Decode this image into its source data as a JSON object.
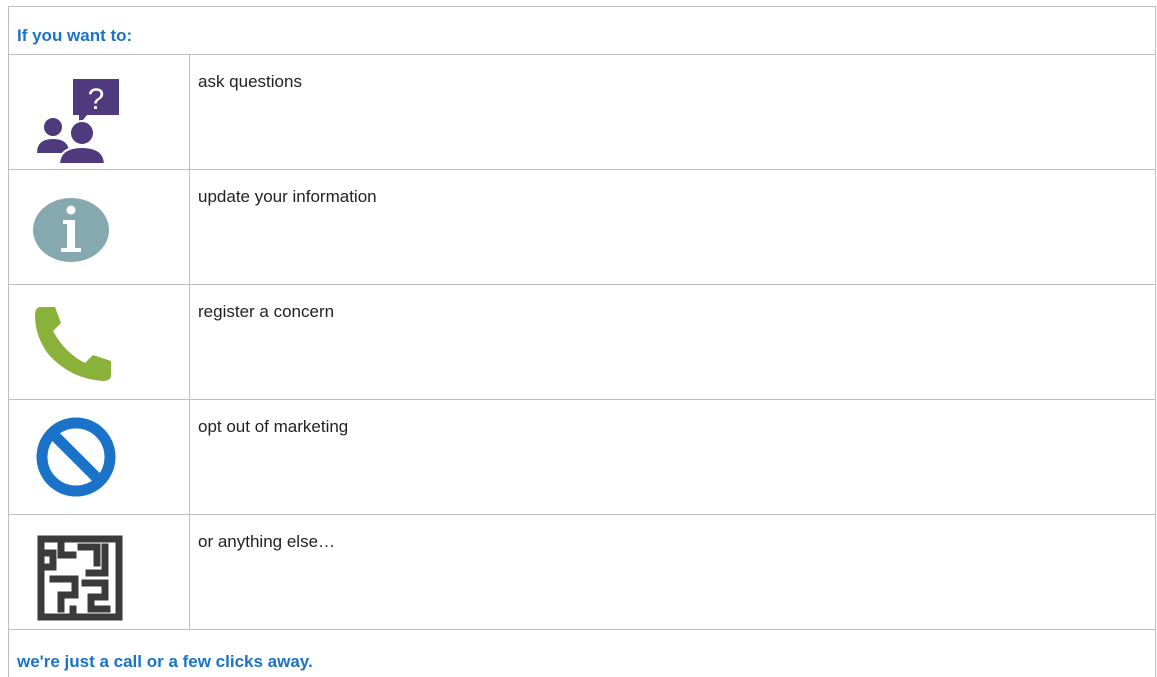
{
  "header": {
    "title": "If you want to:"
  },
  "rows": [
    {
      "label": "ask questions",
      "icon": "people-question-icon",
      "color": "#4e3a7c"
    },
    {
      "label": "update your information",
      "icon": "info-icon",
      "color": "#86a9b0"
    },
    {
      "label": "register a concern",
      "icon": "phone-icon",
      "color": "#8ab13a"
    },
    {
      "label": "opt out of marketing",
      "icon": "prohibited-icon",
      "color": "#1a73c8"
    },
    {
      "label": "or anything else…",
      "icon": "maze-icon",
      "color": "#3b3b3b"
    }
  ],
  "footer": {
    "text": "we're just a call or a few clicks away."
  },
  "colors": {
    "accent": "#1a73c8",
    "border": "#bfbfbf",
    "text": "#222222"
  }
}
